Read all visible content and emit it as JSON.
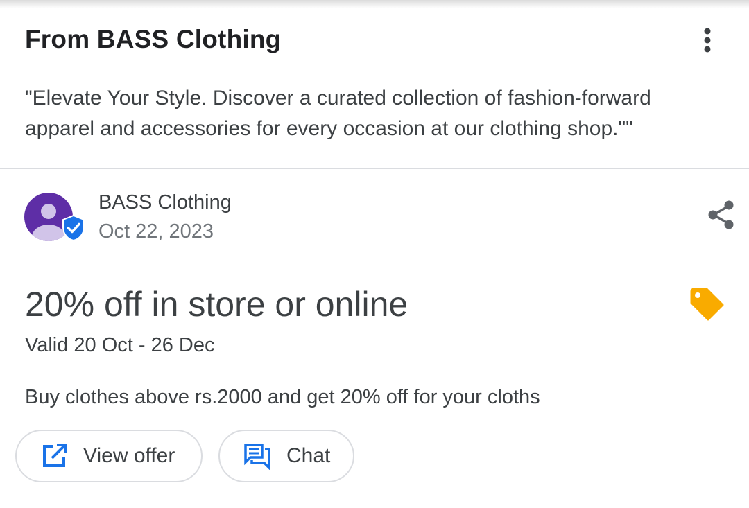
{
  "header": {
    "title": "From BASS Clothing",
    "description": "\"Elevate Your Style. Discover a curated collection of fashion-forward apparel and accessories for every occasion at our clothing shop.\"\""
  },
  "post": {
    "author": "BASS Clothing",
    "date": "Oct 22, 2023",
    "offer_title": "20% off in store or online",
    "validity": "Valid 20 Oct - 26 Dec",
    "offer_description": "Buy clothes above rs.2000 and get 20% off for your cloths",
    "buttons": {
      "view_offer": "View offer",
      "chat": "Chat"
    }
  },
  "icons": {
    "more": "more-vert-icon",
    "verified": "verified-badge-icon",
    "share": "share-icon",
    "tag": "tag-icon",
    "open_in_new": "open-in-new-icon",
    "chat": "chat-icon"
  },
  "colors": {
    "avatar_bg": "#5e2ea6",
    "verified_blue": "#1a73e8",
    "tag_yellow": "#f9ab00",
    "action_blue": "#1a73e8"
  }
}
